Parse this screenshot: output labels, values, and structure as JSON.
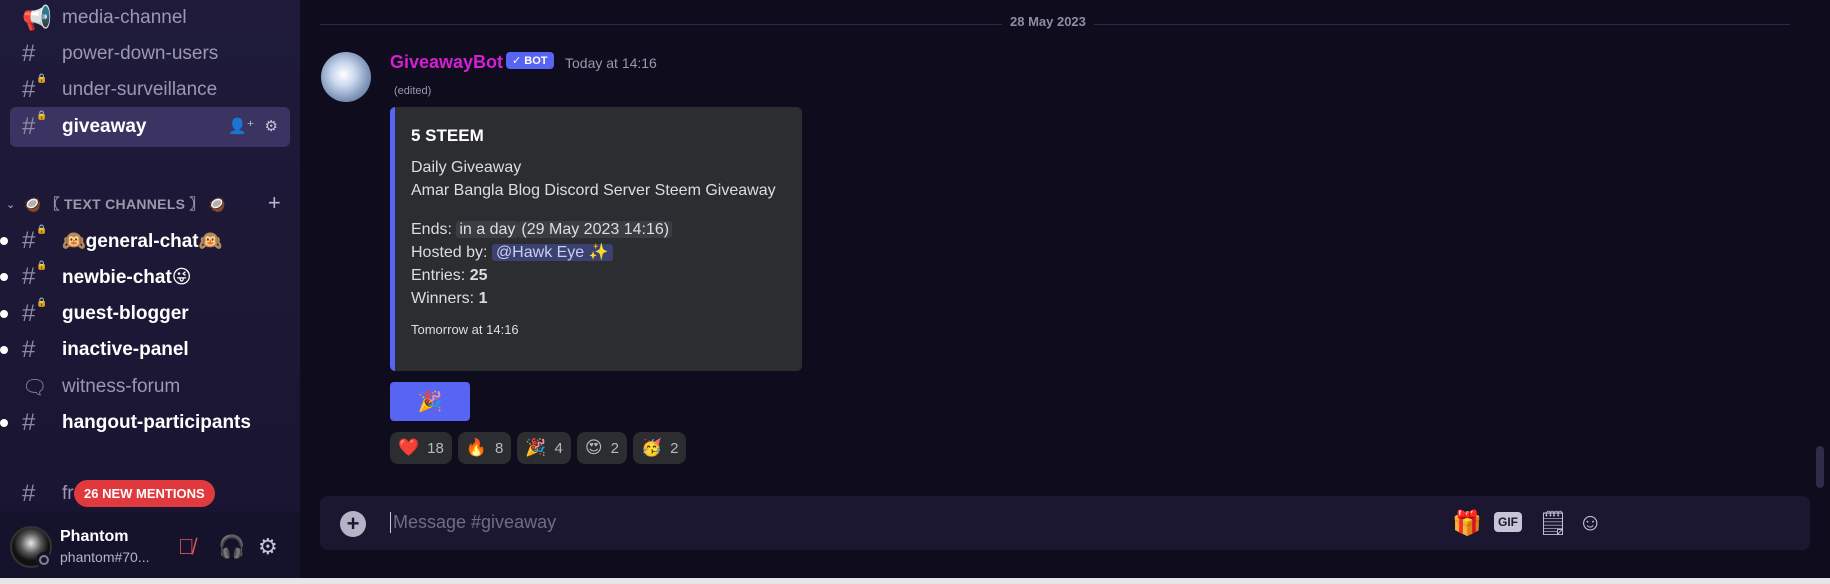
{
  "sidebar": {
    "channels": [
      {
        "name": "media-channel",
        "icon": "megaphone-icon"
      },
      {
        "name": "power-down-users",
        "icon": "hash-icon"
      },
      {
        "name": "under-surveillance",
        "icon": "hash-lock-icon"
      },
      {
        "name": "giveaway",
        "icon": "hash-lock-icon"
      }
    ],
    "category": {
      "label": "〖 TEXT CHANNELS 〗",
      "emoji": "🥥"
    },
    "text_channels": [
      {
        "name": "🙉general-chat🙉",
        "icon": "hash-lock-icon"
      },
      {
        "name": "newbie-chat😜",
        "icon": "hash-lock-icon"
      },
      {
        "name": "guest-blogger",
        "icon": "hash-lock-icon"
      },
      {
        "name": "inactive-panel",
        "icon": "hash-icon"
      },
      {
        "name": "witness-forum",
        "icon": "forum-icon"
      },
      {
        "name": "hangout-participants",
        "icon": "hash-icon"
      },
      {
        "name": "fre",
        "icon": "hash-icon"
      }
    ],
    "mentions_pill": "26 NEW MENTIONS"
  },
  "user": {
    "name": "Phantom",
    "tag": "phantom#70..."
  },
  "chat": {
    "date_divider": "28 May 2023",
    "message": {
      "author": "GiveawayBot",
      "badge": "✓ BOT",
      "time": "Today at 14:16",
      "edited": "(edited)",
      "embed": {
        "title": "5 STEEM",
        "line1": "Daily Giveaway",
        "line2": "Amar Bangla Blog Discord Server Steem Giveaway",
        "ends_label": "Ends:",
        "ends_relative": "in a day",
        "ends_absolute": "(29 May 2023 14:16)",
        "hosted_label": "Hosted by:",
        "host": "@Hawk Eye ✨",
        "entries_label": "Entries:",
        "entries": "25",
        "winners_label": "Winners:",
        "winners": "1",
        "footer": "Tomorrow at 14:16"
      },
      "button_emoji": "🎉",
      "reactions": [
        {
          "emoji": "❤️",
          "count": "18"
        },
        {
          "emoji": "🔥",
          "count": "8"
        },
        {
          "emoji": "🎉",
          "count": "4"
        },
        {
          "emoji": "😍",
          "count": "2"
        },
        {
          "emoji": "🥳",
          "count": "2"
        }
      ]
    },
    "composer_placeholder": "Message #giveaway",
    "gif_label": "GIF"
  },
  "colors": {
    "accent": "#5865f2",
    "bot_name": "#d41fd6",
    "mention_pill": "#e03a3e"
  }
}
